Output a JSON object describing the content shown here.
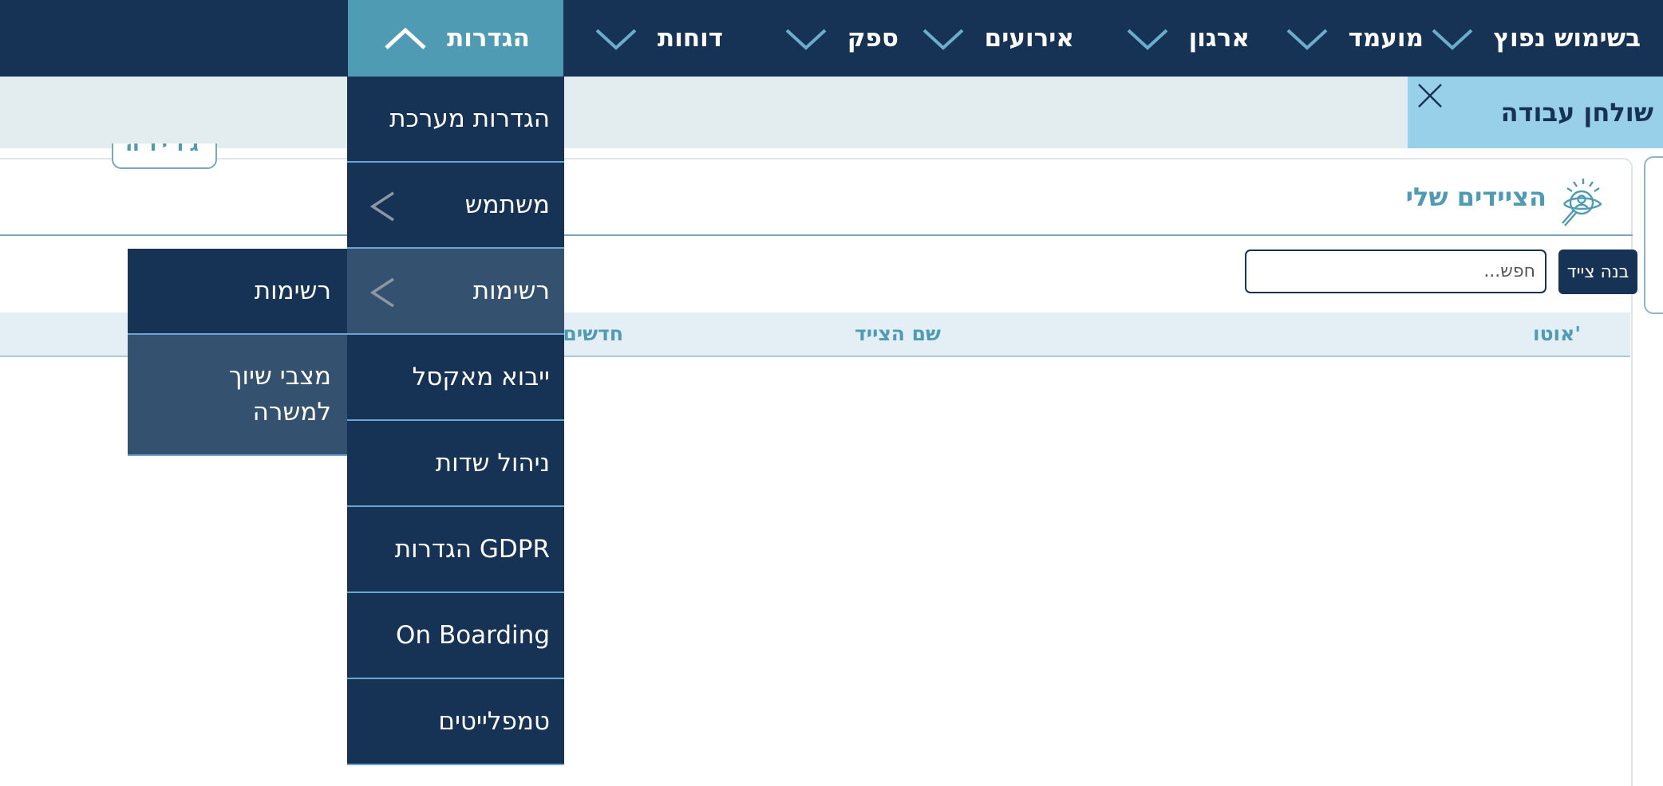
{
  "nav": {
    "items": [
      {
        "label": "בשימוש נפוץ"
      },
      {
        "label": "מועמד"
      },
      {
        "label": "ארגון"
      },
      {
        "label": "אירועים"
      },
      {
        "label": "ספק"
      },
      {
        "label": "דוחות"
      },
      {
        "label": "הגדרות",
        "active": true
      }
    ]
  },
  "workbar": {
    "title": "שולחן עבודה"
  },
  "ghost_button": {
    "label": "גדירה"
  },
  "widget": {
    "title": "הציידים שלי",
    "build_button": "בנה צייד",
    "search_placeholder": "חפש...",
    "columns": [
      "אוטו'",
      "שם הצייד",
      "חדשים"
    ]
  },
  "settings_menu": {
    "items": [
      {
        "label": "הגדרות מערכת"
      },
      {
        "label": "משתמש",
        "has_submenu": true
      },
      {
        "label": "רשימות",
        "has_submenu": true,
        "highlighted": true
      },
      {
        "label": "ייבוא מאקסל"
      },
      {
        "label": "ניהול שדות"
      },
      {
        "label": "הגדרות GDPR"
      },
      {
        "label": "On Boarding"
      },
      {
        "label": "טמפלייטים"
      }
    ]
  },
  "lists_submenu": {
    "items": [
      {
        "label": "רשימות"
      },
      {
        "label": "מצבי שיוך למשרה"
      }
    ]
  },
  "colors": {
    "navy": "#163356",
    "teal": "#4f9bb4",
    "light_blue": "#98d0ea",
    "highlight": "#34516f",
    "workbar_bg": "#e3ecef",
    "table_head_bg": "#e3eff4"
  }
}
